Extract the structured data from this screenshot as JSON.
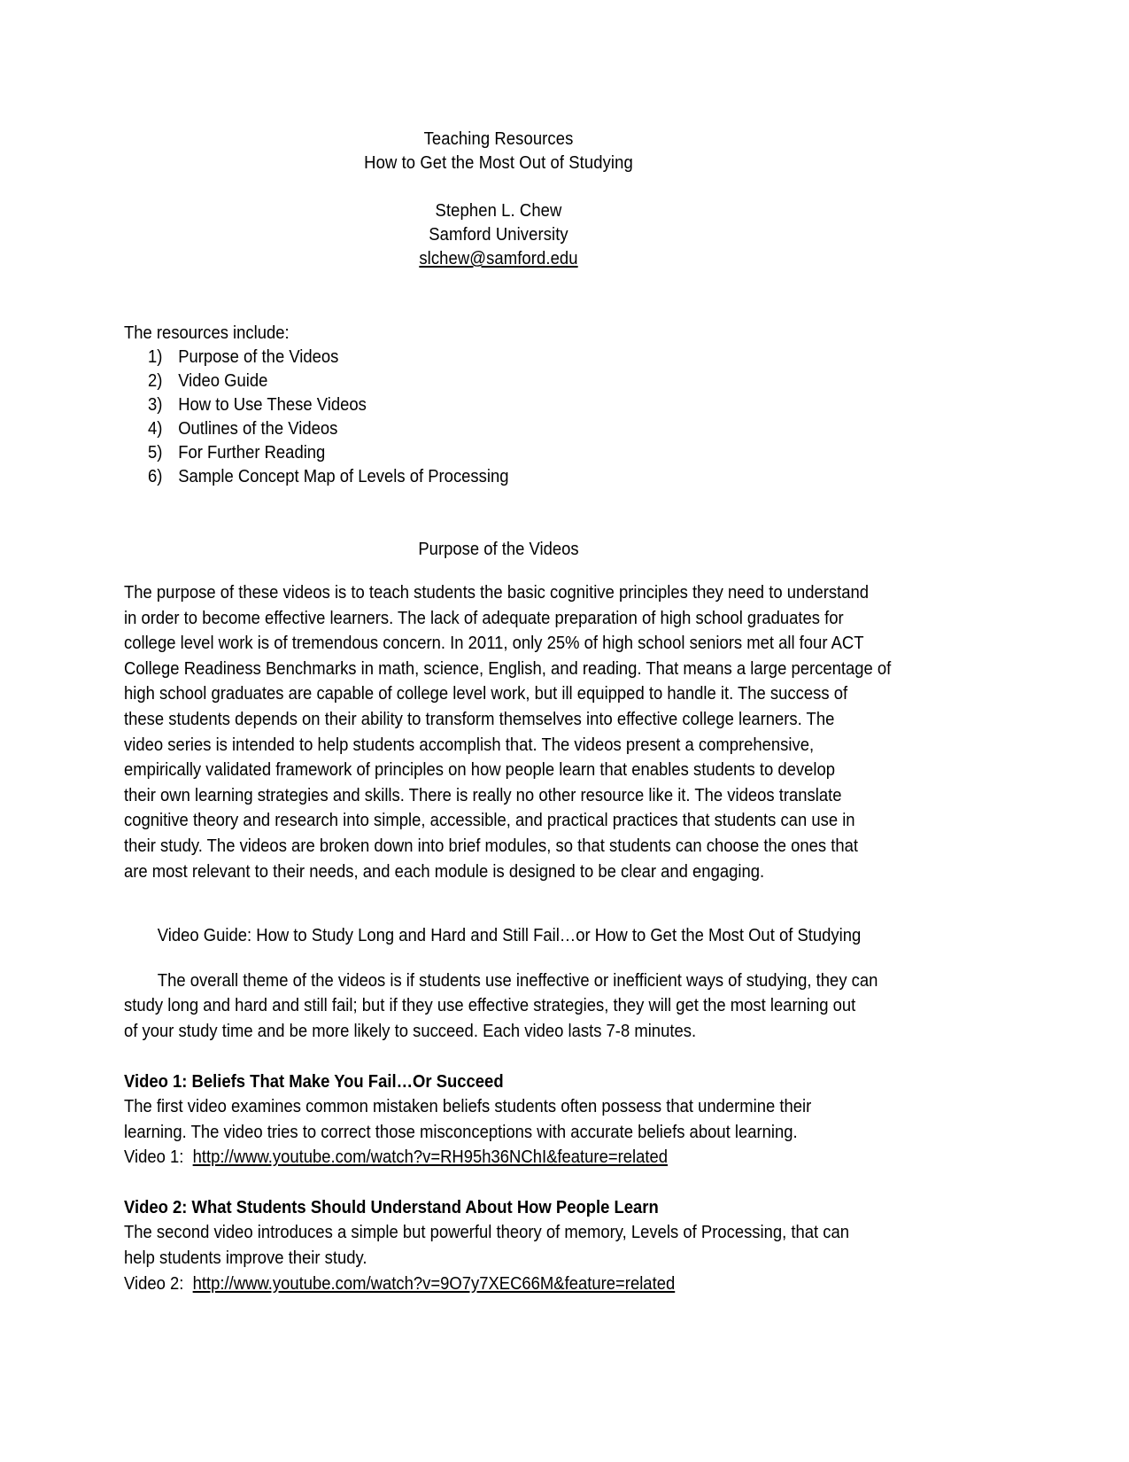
{
  "document": {
    "header": {
      "title_line1": "Teaching Resources",
      "title_line2": "How to Get the Most Out of Studying",
      "author": "Stephen L. Chew",
      "affiliation": "Samford University",
      "email": "slchew@samford.edu"
    },
    "resources": {
      "intro": "The resources include:",
      "items": [
        {
          "num": "1)",
          "label": "Purpose of the Videos"
        },
        {
          "num": "2)",
          "label": "Video Guide"
        },
        {
          "num": "3)",
          "label": "How to Use These Videos"
        },
        {
          "num": "4)",
          "label": "Outlines of the Videos"
        },
        {
          "num": "5)",
          "label": "For Further Reading"
        },
        {
          "num": "6)",
          "label": "Sample Concept Map of Levels of Processing"
        }
      ]
    },
    "purpose_section": {
      "heading": "Purpose of the Videos",
      "paragraph_lines": [
        "The purpose of these videos is to teach students the basic cognitive principles they need to understand",
        "in order to become effective learners. The lack of adequate preparation of high school graduates for",
        "college level work is of tremendous concern. In 2011, only 25% of high school seniors met all four ACT",
        "College Readiness Benchmarks in math, science, English, and reading. That means a large percentage of",
        "high school graduates are capable of college level work, but ill equipped to handle it. The success of",
        "these students depends on their ability to transform themselves into effective college learners. The",
        "video series is intended to help students accomplish that. The videos present a comprehensive,",
        "empirically validated framework of principles on how people learn that enables students to develop",
        "their own learning strategies and skills. There is really no other resource like it. The videos translate",
        "cognitive theory and research into simple, accessible, and practical practices that students can use in",
        "their study. The videos are broken down into brief modules, so that students can choose the ones that",
        "are most relevant to their needs, and each module is designed to be clear and engaging."
      ]
    },
    "video_guide_section": {
      "heading": "Video Guide: How to Study Long and Hard and Still Fail…or How to Get the Most Out of Studying",
      "theme_lines": [
        "The overall theme of the videos is if students use ineffective or inefficient ways of studying, they can",
        "study long and hard and still fail; but if they use effective strategies, they will get the most learning out",
        "of your study time and be more likely to succeed. Each video lasts 7-8 minutes."
      ]
    },
    "videos": [
      {
        "heading": "Video 1: Beliefs That Make You Fail…Or Succeed",
        "description_lines": [
          "The first video examines common mistaken beliefs students often possess that undermine their",
          "learning. The video tries to correct those misconceptions with accurate beliefs about learning."
        ],
        "url_label": "Video 1:",
        "url": "http://www.youtube.com/watch?v=RH95h36NChI&feature=related"
      },
      {
        "heading": "Video 2: What Students Should Understand About How People Learn",
        "description_lines": [
          "The second video introduces a simple but powerful theory of memory, Levels of Processing, that can",
          "help students improve their study."
        ],
        "url_label": "Video 2:",
        "url": "http://www.youtube.com/watch?v=9O7y7XEC66M&feature=related"
      }
    ]
  }
}
